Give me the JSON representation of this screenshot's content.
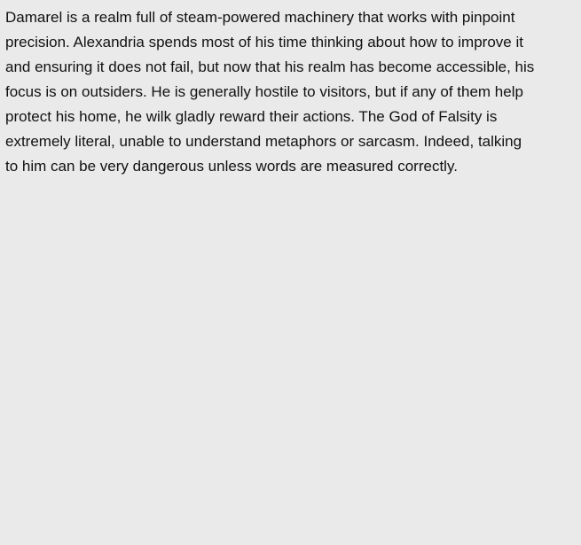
{
  "document": {
    "paragraph_lines": [
      "Damarel is a realm full of steam-powered machinery that works with pinpoint",
      "precision. Alexandria spends most of his time thinking about how to improve it",
      "and ensuring it does not fail, but now that his realm has become accessible, his",
      "focus is on outsiders. He is generally hostile to visitors, but if any of them help",
      "protect his home, he wilk gladly reward their actions. The God of Falsity is",
      "extremely literal, unable to understand metaphors or sarcasm. Indeed, talking",
      "to him can be very dangerous unless words are measured correctly."
    ]
  },
  "colors": {
    "background": "#eaeaea",
    "text": "#111111"
  }
}
